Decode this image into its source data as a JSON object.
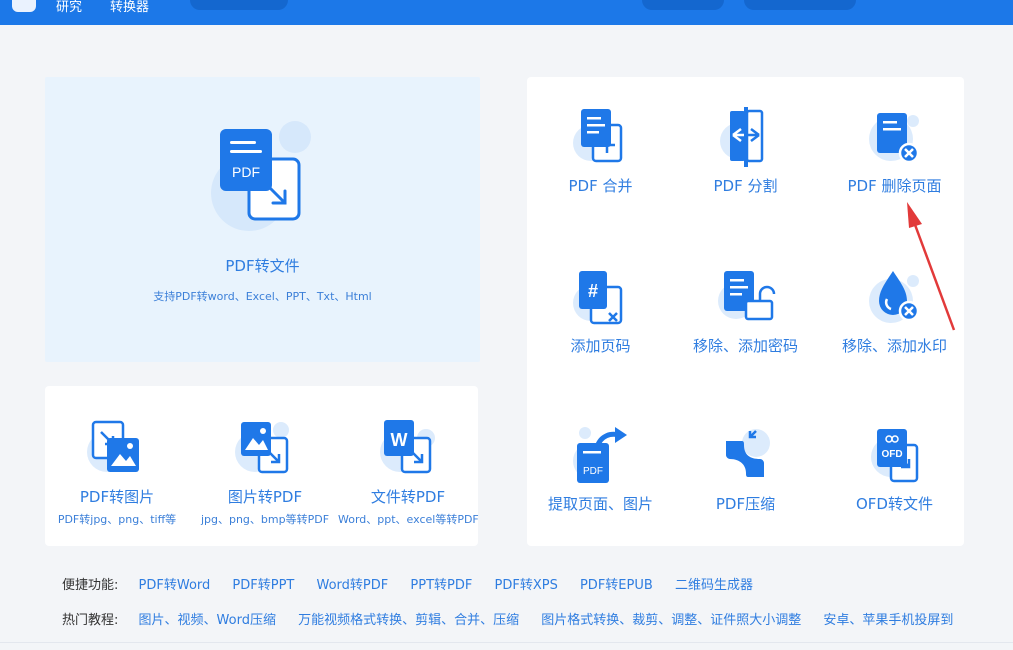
{
  "topbar": {
    "nav": [
      "研究",
      "转换器"
    ]
  },
  "hero": {
    "title": "PDF转文件",
    "sub": "支持PDF转word、Excel、PPT、Txt、Html",
    "badge": "PDF"
  },
  "left_tools": [
    {
      "label": "PDF转图片",
      "sub": "PDF转jpg、png、tiff等"
    },
    {
      "label": "图片转PDF",
      "sub": "jpg、png、bmp等转PDF"
    },
    {
      "label": "文件转PDF",
      "sub": "Word、ppt、excel等转PDF"
    }
  ],
  "right_tools": [
    {
      "label": "PDF 合并"
    },
    {
      "label": "PDF 分割"
    },
    {
      "label": "PDF 删除页面"
    },
    {
      "label": "添加页码"
    },
    {
      "label": "移除、添加密码"
    },
    {
      "label": "移除、添加水印"
    },
    {
      "label": "提取页面、图片",
      "badge": "PDF"
    },
    {
      "label": "PDF压缩"
    },
    {
      "label": "OFD转文件",
      "badge": "OFD"
    }
  ],
  "shortcuts": {
    "label": "便捷功能:",
    "links": [
      "PDF转Word",
      "PDF转PPT",
      "Word转PDF",
      "PPT转PDF",
      "PDF转XPS",
      "PDF转EPUB",
      "二维码生成器"
    ]
  },
  "tutorials": {
    "label": "热门教程:",
    "links": [
      "图片、视频、Word压缩",
      "万能视频格式转换、剪辑、合并、压缩",
      "图片格式转换、裁剪、调整、证件照大小调整",
      "安卓、苹果手机投屏到"
    ]
  },
  "colors": {
    "primary": "#1c78e8",
    "hero_bg": "#e8f3fd",
    "accent": "#2f7de0",
    "annotation": "#e23a3a"
  },
  "icons": [
    "pdf-convert-icon",
    "pdf-to-image-icon",
    "image-to-pdf-icon",
    "file-to-pdf-icon",
    "pdf-merge-icon",
    "pdf-split-icon",
    "pdf-delete-page-icon",
    "add-page-number-icon",
    "password-lock-icon",
    "watermark-icon",
    "extract-page-icon",
    "pdf-compress-icon",
    "ofd-convert-icon",
    "red-annotation-arrow"
  ]
}
